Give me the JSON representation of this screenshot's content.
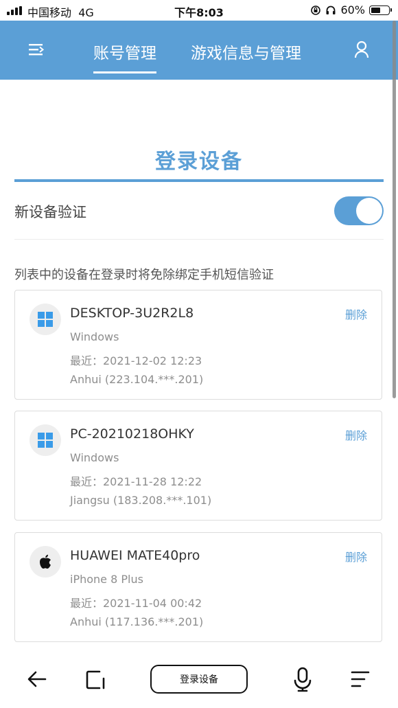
{
  "status_bar": {
    "carrier": "中国移动",
    "network": "4G",
    "time": "下午8:03",
    "battery": "60%",
    "battery_level": 0.6
  },
  "nav": {
    "tabs": [
      {
        "label": "账号管理",
        "active": true
      },
      {
        "label": "游戏信息与管理",
        "active": false
      }
    ],
    "menu_icon": "menu-collapse-icon",
    "user_icon": "user-icon"
  },
  "section": {
    "title": "登录设备",
    "toggle_label": "新设备验证",
    "toggle_on": true,
    "description": "列表中的设备在登录时将免除绑定手机短信验证"
  },
  "devices": [
    {
      "name": "DESKTOP-3U2R2L8",
      "os": "Windows",
      "recent": "最近：2021-12-02 12:23",
      "location": "Anhui (223.104.***.201)",
      "icon": "windows-icon",
      "delete_label": "删除"
    },
    {
      "name": "PC-20210218OHKY",
      "os": "Windows",
      "recent": "最近：2021-11-28 12:22",
      "location": "Jiangsu (183.208.***.101)",
      "icon": "windows-icon",
      "delete_label": "删除"
    },
    {
      "name": "HUAWEI MATE40pro",
      "os": "iPhone 8 Plus",
      "recent": "最近：2021-11-04 00:42",
      "location": "Anhui (117.136.***.201)",
      "icon": "apple-icon",
      "delete_label": "删除"
    }
  ],
  "bottom_bar": {
    "page_label": "登录设备"
  },
  "colors": {
    "accent": "#5b9fd6",
    "muted_text": "#8e8e8e"
  }
}
